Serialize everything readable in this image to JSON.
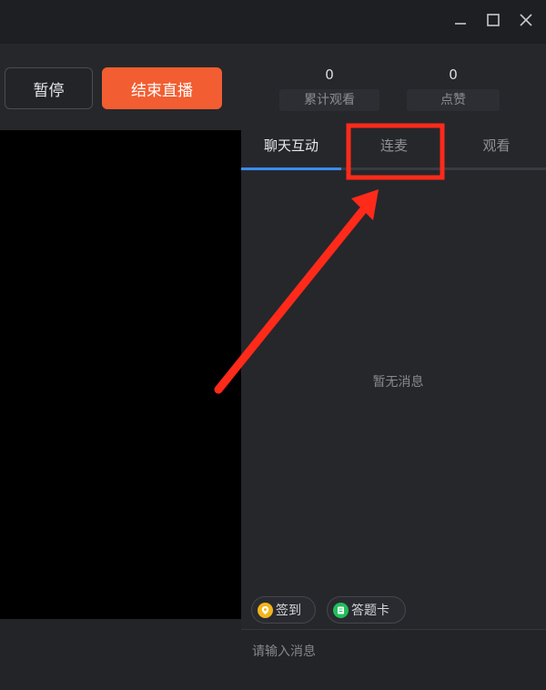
{
  "window": {
    "buttons": [
      {
        "name": "minimize",
        "icon": "minimize-icon"
      },
      {
        "name": "maximize",
        "icon": "maximize-icon"
      },
      {
        "name": "close",
        "icon": "close-icon"
      }
    ]
  },
  "controls": {
    "pause_label": "暂停",
    "end_label": "结束直播"
  },
  "stats": {
    "total_views_value": "0",
    "total_views_label": "累计观看",
    "likes_value": "0",
    "likes_label": "点赞"
  },
  "tabs": [
    {
      "label": "聊天互动",
      "active": true
    },
    {
      "label": "连麦",
      "active": false
    },
    {
      "label": "观看",
      "active": false
    }
  ],
  "chat": {
    "empty_text": "暂无消息",
    "sign_in_label": "签到",
    "answer_card_label": "答题卡",
    "input_placeholder": "请输入消息"
  },
  "colors": {
    "accent_orange": "#f25d31",
    "tab_active_blue": "#3b8cff",
    "annotation_red": "#ff2a1a",
    "sign_in_icon": "#f2b51b",
    "answer_card_icon": "#1fbf5a"
  }
}
